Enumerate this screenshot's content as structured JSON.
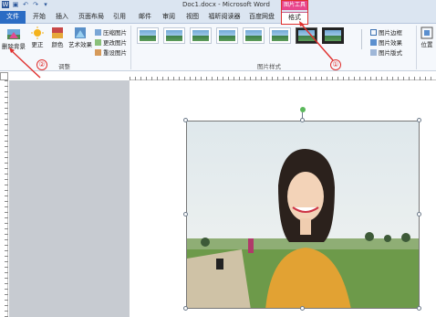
{
  "title_bar": {
    "document_title": "Doc1.docx - Microsoft Word",
    "contextual_tab_group": "图片工具"
  },
  "tabs": [
    {
      "label": "文件"
    },
    {
      "label": "开始"
    },
    {
      "label": "插入"
    },
    {
      "label": "页面布局"
    },
    {
      "label": "引用"
    },
    {
      "label": "邮件"
    },
    {
      "label": "审阅"
    },
    {
      "label": "视图"
    },
    {
      "label": "福昕阅读器"
    },
    {
      "label": "百度网盘"
    },
    {
      "label": "格式"
    }
  ],
  "ribbon": {
    "remove_background": "删除背景",
    "corrections": "更正",
    "color": "颜色",
    "artistic_effects": "艺术效果",
    "compress_pictures": "压缩图片",
    "change_picture": "更改图片",
    "reset_picture": "重设图片",
    "adjust_group_label": "调整",
    "picture_styles_group_label": "图片样式",
    "picture_border": "图片边框",
    "picture_effects": "图片效果",
    "picture_layout": "图片版式",
    "position": "位置"
  },
  "annotations": {
    "step1": "①",
    "step2": "②"
  },
  "colors": {
    "accent_red": "#e0302e",
    "contextual_pink": "#e8478d",
    "file_tab_blue": "#2b6cc4"
  }
}
